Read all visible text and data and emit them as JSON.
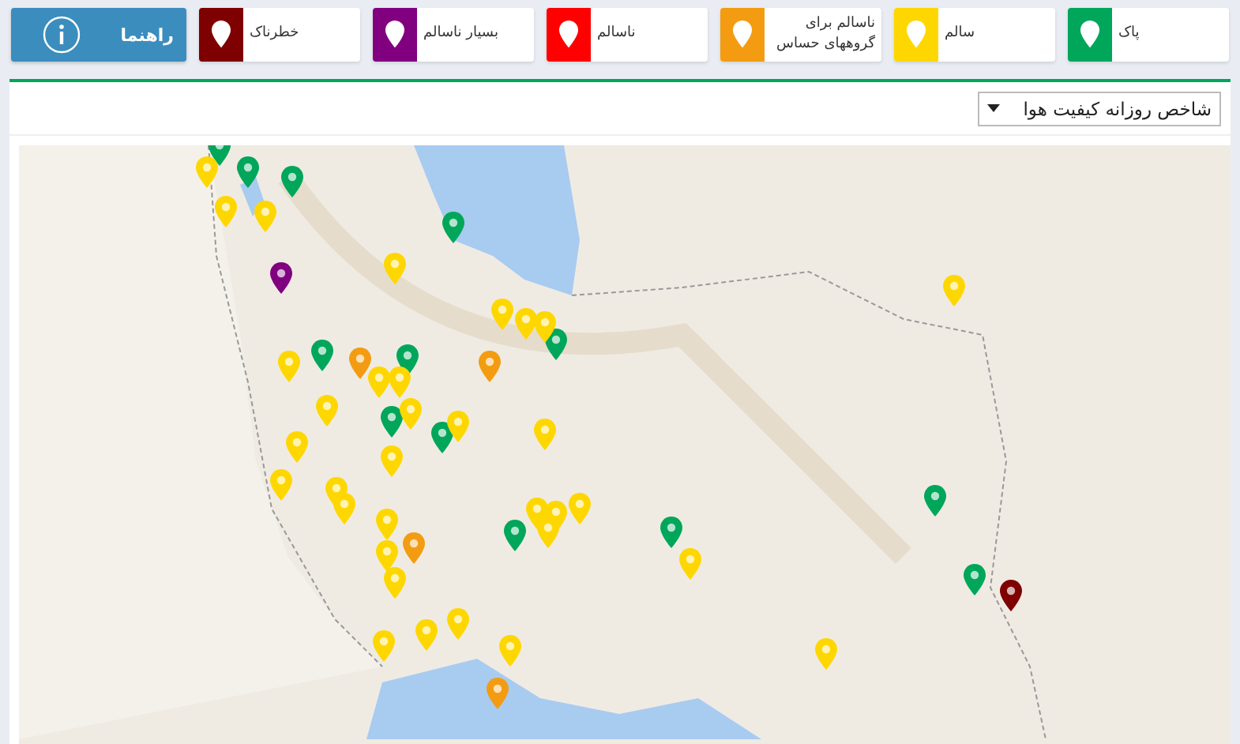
{
  "help_button": {
    "label": "راهنما"
  },
  "legend": [
    {
      "label": "پاک",
      "color": "#00a65a"
    },
    {
      "label": "سالم",
      "color": "#ffd700"
    },
    {
      "label": "ناسالم برای گروههای حساس",
      "color": "#f39c12"
    },
    {
      "label": "ناسالم",
      "color": "#ff0000"
    },
    {
      "label": "بسیار ناسالم",
      "color": "#800080"
    },
    {
      "label": "خطرناک",
      "color": "#7e0000"
    }
  ],
  "index_select": {
    "value": "شاخص روزانه کیفیت هوا"
  },
  "map": {
    "markers": [
      {
        "color": "#00a65a"
      },
      {
        "color": "#00a65a"
      },
      {
        "color": "#00a65a"
      },
      {
        "color": "#00a65a"
      },
      {
        "color": "#00a65a"
      },
      {
        "color": "#00a65a"
      },
      {
        "color": "#00a65a"
      },
      {
        "color": "#00a65a"
      },
      {
        "color": "#00a65a"
      },
      {
        "color": "#00a65a"
      },
      {
        "color": "#00a65a"
      },
      {
        "color": "#00a65a"
      },
      {
        "color": "#00a65a"
      },
      {
        "color": "#ffd700"
      },
      {
        "color": "#ffd700"
      },
      {
        "color": "#ffd700"
      },
      {
        "color": "#ffd700"
      },
      {
        "color": "#ffd700"
      },
      {
        "color": "#ffd700"
      },
      {
        "color": "#ffd700"
      },
      {
        "color": "#ffd700"
      },
      {
        "color": "#ffd700"
      },
      {
        "color": "#ffd700"
      },
      {
        "color": "#ffd700"
      },
      {
        "color": "#ffd700"
      },
      {
        "color": "#ffd700"
      },
      {
        "color": "#ffd700"
      },
      {
        "color": "#ffd700"
      },
      {
        "color": "#ffd700"
      },
      {
        "color": "#ffd700"
      },
      {
        "color": "#ffd700"
      },
      {
        "color": "#ffd700"
      },
      {
        "color": "#ffd700"
      },
      {
        "color": "#ffd700"
      },
      {
        "color": "#ffd700"
      },
      {
        "color": "#ffd700"
      },
      {
        "color": "#ffd700"
      },
      {
        "color": "#ffd700"
      },
      {
        "color": "#ffd700"
      },
      {
        "color": "#ffd700"
      },
      {
        "color": "#ffd700"
      },
      {
        "color": "#ffd700"
      },
      {
        "color": "#ffd700"
      },
      {
        "color": "#ffd700"
      },
      {
        "color": "#ffd700"
      },
      {
        "color": "#ffd700"
      },
      {
        "color": "#f39c12"
      },
      {
        "color": "#f39c12"
      },
      {
        "color": "#f39c12"
      },
      {
        "color": "#f39c12"
      },
      {
        "color": "#800080"
      },
      {
        "color": "#7e0000"
      }
    ]
  }
}
